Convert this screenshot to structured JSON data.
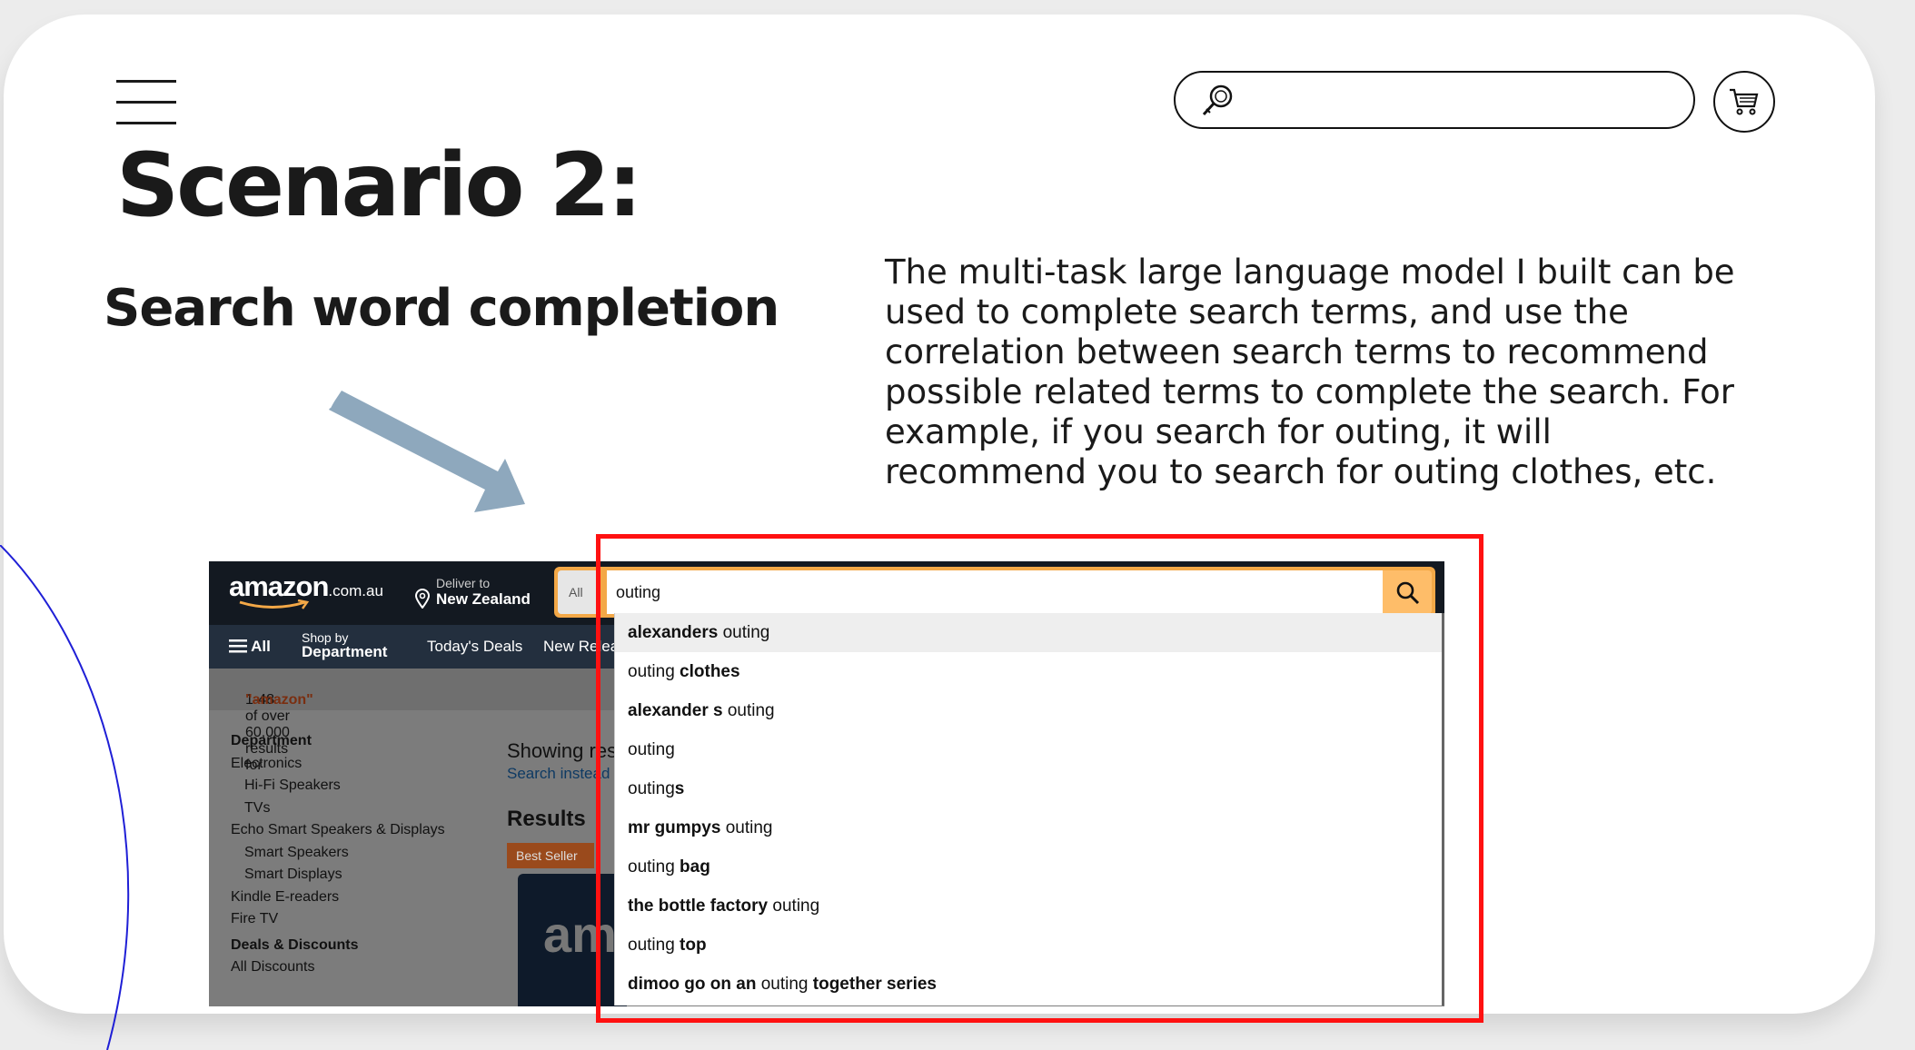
{
  "slide": {
    "title": "Scenario 2:",
    "subtitle": "Search word completion",
    "description": "The multi-task large language model I built can be used to complete search terms, and use the correlation between search terms to recommend possible related terms to complete the search. For example, if you search for outing, it will recommend you to search for outing clothes, etc.",
    "colors": {
      "arrow": "#8ea8bd",
      "highlight_box": "#ff1111",
      "curve": "#1f1fd6"
    }
  },
  "header_icons": {
    "menu": "hamburger-icon",
    "search": "magnifier-icon",
    "cart": "cart-icon"
  },
  "amazon": {
    "logo_main": "amazon",
    "logo_tld": ".com.au",
    "deliver_label": "Deliver to",
    "deliver_location": "New Zealand",
    "search_category": "All",
    "search_value": "outing",
    "nav": {
      "all": "All",
      "shop_by": "Shop by",
      "department": "Department",
      "todays_deals": "Today's Deals",
      "new_releases": "New Releases"
    },
    "results_prefix": "1-48 of over 60,000 results for ",
    "results_query": "\"amazon\"",
    "sidebar": [
      {
        "text": "Department",
        "type": "h"
      },
      {
        "text": "Electronics",
        "type": "n"
      },
      {
        "text": "Hi-Fi Speakers",
        "type": "i"
      },
      {
        "text": "TVs",
        "type": "i"
      },
      {
        "text": "Echo Smart Speakers & Displays",
        "type": "n"
      },
      {
        "text": "Smart Speakers",
        "type": "i"
      },
      {
        "text": "Smart Displays",
        "type": "i"
      },
      {
        "text": "Kindle E-readers",
        "type": "n"
      },
      {
        "text": "Fire TV",
        "type": "n"
      },
      {
        "text": "Deals & Discounts",
        "type": "h2"
      },
      {
        "text": "All Discounts",
        "type": "n"
      }
    ],
    "main_showing": "Showing res",
    "main_search_instead": "Search instead",
    "main_results": "Results",
    "best_seller": "Best Seller",
    "product_text": "am",
    "suggestions": [
      [
        {
          "t": "alexanders",
          "b": true
        },
        {
          "t": " outing",
          "b": false
        }
      ],
      [
        {
          "t": "outing ",
          "b": false
        },
        {
          "t": "clothes",
          "b": true
        }
      ],
      [
        {
          "t": "alexander s",
          "b": true
        },
        {
          "t": " outing",
          "b": false
        }
      ],
      [
        {
          "t": "outing",
          "b": false
        }
      ],
      [
        {
          "t": "outing",
          "b": false
        },
        {
          "t": "s",
          "b": true
        }
      ],
      [
        {
          "t": "mr gumpys",
          "b": true
        },
        {
          "t": " outing",
          "b": false
        }
      ],
      [
        {
          "t": "outing ",
          "b": false
        },
        {
          "t": "bag",
          "b": true
        }
      ],
      [
        {
          "t": "the bottle factory",
          "b": true
        },
        {
          "t": " outing",
          "b": false
        }
      ],
      [
        {
          "t": "outing ",
          "b": false
        },
        {
          "t": "top",
          "b": true
        }
      ],
      [
        {
          "t": "dimoo go on an",
          "b": true
        },
        {
          "t": " outing ",
          "b": false
        },
        {
          "t": "together series",
          "b": true
        }
      ]
    ]
  }
}
